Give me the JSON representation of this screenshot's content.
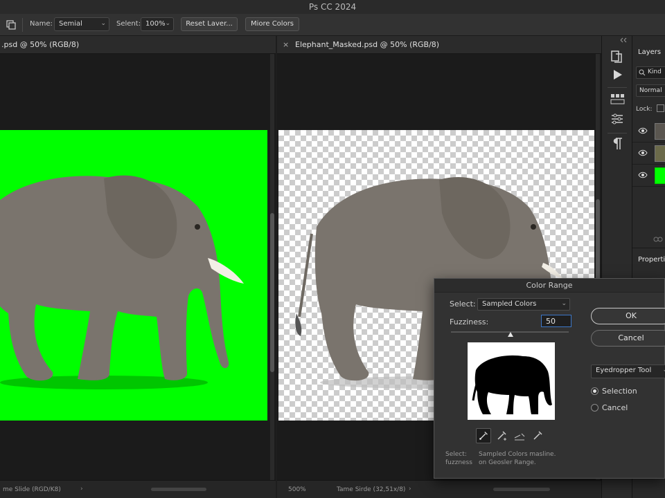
{
  "app": {
    "title": "Ps CC 2024"
  },
  "options_bar": {
    "name_label": "Name:",
    "name_value": "Semial",
    "select_label": "Selent:",
    "select_value": "100%",
    "reset_label": "Reset Laver...",
    "more_colors_label": "Miore Colors"
  },
  "doc_left": {
    "tab_title": ".psd @ 50% (RGB/8)",
    "status_text": "me Slide (RGD/K8)",
    "canvas_color": "#00ff00"
  },
  "doc_right": {
    "tab_title": "Elephant_Masked.psd @ 50% (RGB/8)",
    "close_glyph": "×",
    "status_zoom": "500%",
    "status_text": "Tame Sirde (32,51x/8)"
  },
  "layers_panel": {
    "title": "Layers",
    "search_label": "Kind",
    "blend_mode": "Normal",
    "lock_label": "Lock:",
    "properties_title": "Properti"
  },
  "color_range": {
    "title": "Color Range",
    "select_label": "Select:",
    "select_value": "Sampled Colors",
    "fuzziness_label": "Fuzziness:",
    "fuzziness_value": "50",
    "ok_label": "OK",
    "cancel_label": "Cancel",
    "tool_value": "Eyedropper  Tool",
    "radio_selection": "Selection",
    "radio_cancel": "Cancel",
    "help_label_1": "Select:",
    "help_label_2": "fuzzness",
    "help_text_1": "Sampled Colors masline.",
    "help_text_2": "on Geosler Range."
  },
  "colors": {
    "accent_green": "#00ff00",
    "panel_bg": "#2a2a2a"
  }
}
